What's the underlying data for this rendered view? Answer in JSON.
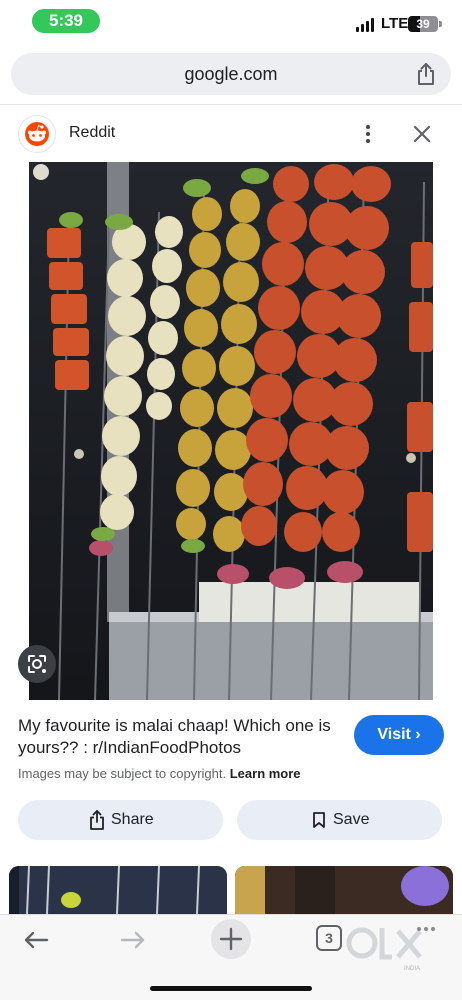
{
  "status_bar": {
    "time": "5:39",
    "network": "LTE",
    "battery": "39",
    "battery_level": 0.39
  },
  "address_bar": {
    "url": "google.com",
    "share_icon": "share-icon"
  },
  "source": {
    "name": "Reddit",
    "logo_icon": "reddit-icon",
    "more_icon": "more-vertical-icon",
    "close_icon": "close-icon"
  },
  "image": {
    "lens_icon": "google-lens-icon"
  },
  "result": {
    "caption": "My favourite is malai chaap! Which one is yours?? : r/IndianFoodPhotos",
    "visit_label": "Visit ›",
    "copyright_text": "Images may be subject to copyright.",
    "learn_more": "Learn more"
  },
  "actions": {
    "share_label": "Share",
    "save_label": "Save"
  },
  "toolbar": {
    "tab_count": "3",
    "back_icon": "back-arrow-icon",
    "forward_icon": "forward-arrow-icon",
    "new_tab_icon": "plus-icon",
    "watermark": "OLX",
    "watermark_sub": "INDIA"
  },
  "colors": {
    "accent": "#1a73e8",
    "status_green": "#34c759",
    "reddit_orange": "#ff4500",
    "pill_bg": "#e8edf6"
  }
}
